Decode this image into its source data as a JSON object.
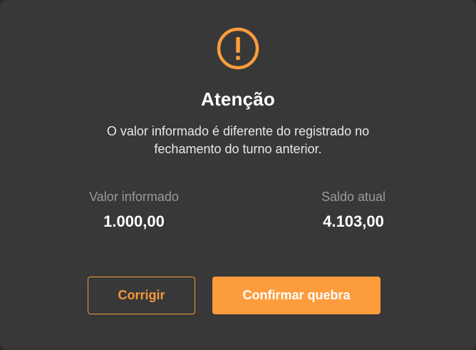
{
  "dialog": {
    "icon": "warning-circle-icon",
    "accent_color": "#fd9c3c",
    "title": "Atenção",
    "message_line1": "O valor informado é diferente do registrado no",
    "message_line2": "fechamento do turno anterior.",
    "stats": {
      "informed_label": "Valor informado",
      "informed_value": "1.000,00",
      "balance_label": "Saldo atual",
      "balance_value": "4.103,00"
    },
    "buttons": {
      "correct_label": "Corrigir",
      "confirm_label": "Confirmar quebra"
    }
  }
}
